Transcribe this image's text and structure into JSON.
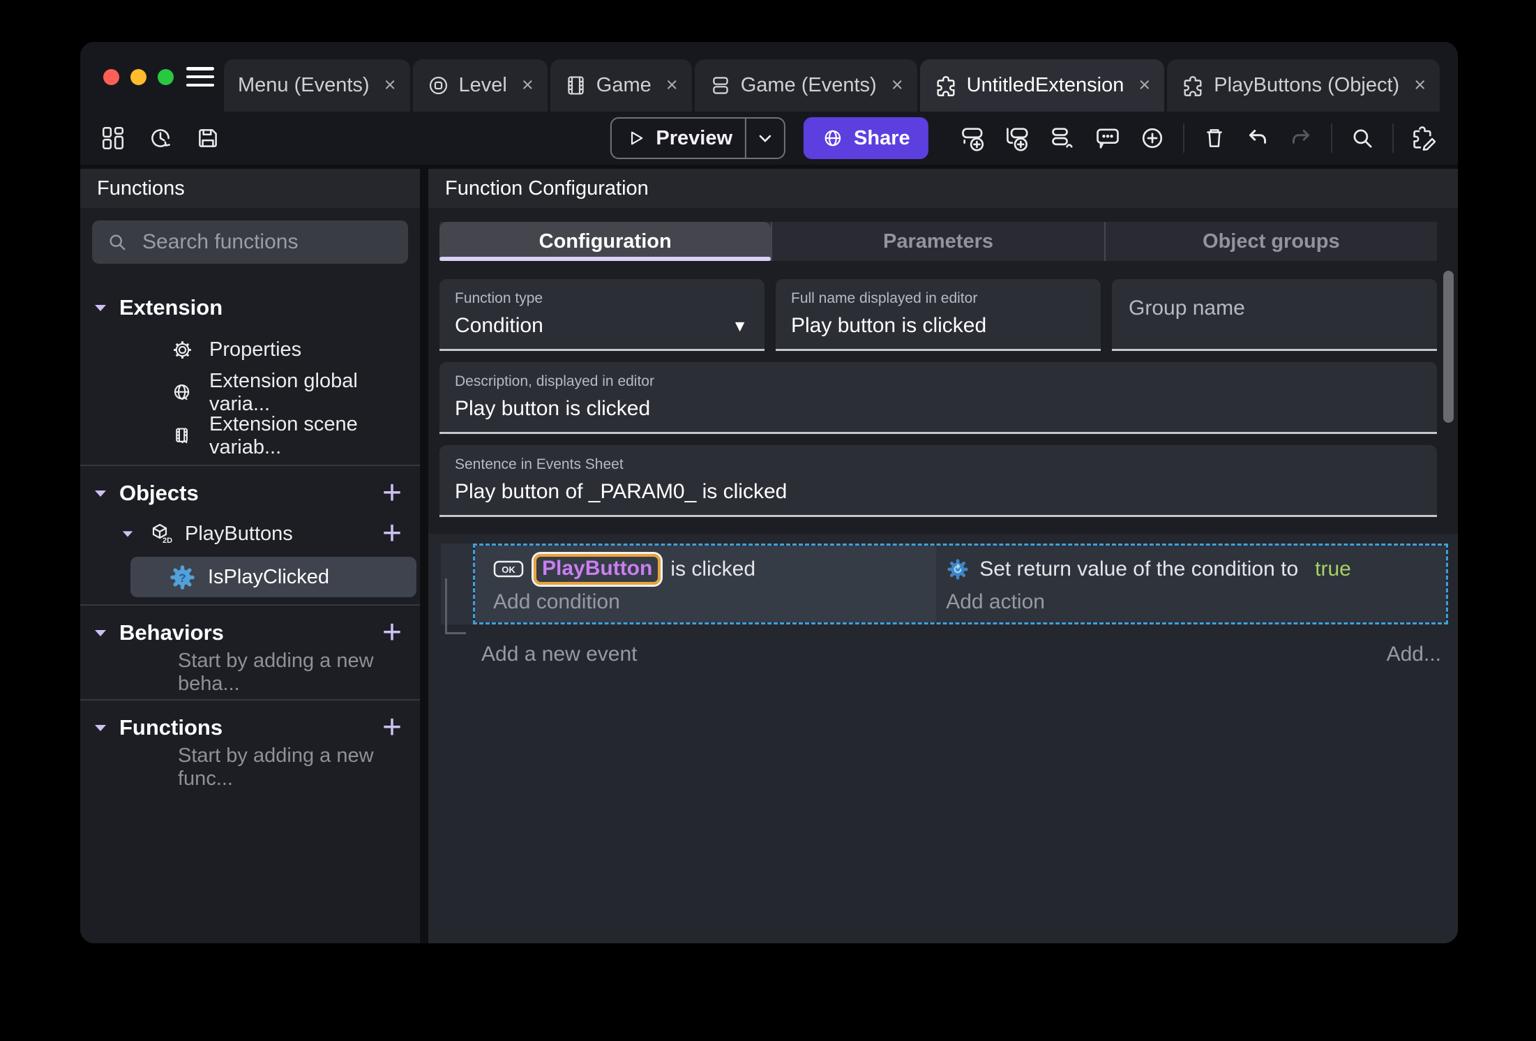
{
  "glyphs": {
    "close": "×",
    "plus": "+",
    "caret_down": "▼"
  },
  "window": {
    "tabs": [
      {
        "label": "Menu (Events)",
        "active": false
      },
      {
        "label": "Level",
        "active": false
      },
      {
        "label": "Game",
        "active": false
      },
      {
        "label": "Game (Events)",
        "active": false
      },
      {
        "label": "UntitledExtension",
        "active": true
      },
      {
        "label": "PlayButtons (Object)",
        "active": false
      }
    ]
  },
  "toolbar": {
    "preview_label": "Preview",
    "share_label": "Share"
  },
  "sidebar": {
    "title": "Functions",
    "search_placeholder": "Search functions",
    "extension": {
      "label": "Extension",
      "items": [
        {
          "label": "Properties"
        },
        {
          "label": "Extension global varia..."
        },
        {
          "label": "Extension scene variab..."
        }
      ]
    },
    "objects": {
      "label": "Objects",
      "object_label": "PlayButtons",
      "function_label": "IsPlayClicked"
    },
    "behaviors": {
      "label": "Behaviors",
      "empty": "Start by adding a new beha..."
    },
    "functions": {
      "label": "Functions",
      "empty": "Start by adding a new func..."
    }
  },
  "main": {
    "title": "Function Configuration",
    "tabs": [
      {
        "label": "Configuration",
        "active": true
      },
      {
        "label": "Parameters",
        "active": false
      },
      {
        "label": "Object groups",
        "active": false
      }
    ],
    "fields": {
      "function_type": {
        "label": "Function type",
        "value": "Condition"
      },
      "full_name": {
        "label": "Full name displayed in editor",
        "value": "Play button is clicked"
      },
      "group_name": {
        "placeholder": "Group name"
      },
      "description": {
        "label": "Description, displayed in editor",
        "value": "Play button is clicked"
      },
      "sentence": {
        "label": "Sentence in Events Sheet",
        "value": "Play button of _PARAM0_ is clicked"
      }
    },
    "events": {
      "ok_badge": "OK",
      "condition_object": "PlayButton",
      "condition_suffix": "is clicked",
      "add_condition": "Add condition",
      "action_prefix": "Set return value of the condition to",
      "action_value": "true",
      "add_action": "Add action",
      "add_new_event": "Add a new event",
      "add_more": "Add..."
    }
  },
  "colors": {
    "accent_purple": "#5d3fe0",
    "accent_lavender": "#cfc0f2",
    "selected_event_border": "#3f9fdc",
    "object_chip_text": "#c97ef0",
    "object_chip_border": "#e8a33d",
    "boolean_true": "#a8d164",
    "traffic_close": "#ff5f57",
    "traffic_minimize": "#febc2e",
    "traffic_zoom": "#28c840"
  },
  "icons": [
    "menu",
    "scene",
    "game",
    "events-sheet",
    "extension-puzzle",
    "project-manager",
    "history",
    "save",
    "play",
    "chevron-down",
    "globe",
    "add-event",
    "add-subevent",
    "add-other-events",
    "add-comment",
    "add-circle",
    "trash",
    "undo",
    "redo",
    "search",
    "edit-extension",
    "gear",
    "global-variable",
    "scene-variable",
    "cube-2d",
    "function-question",
    "ok-button",
    "action-gear"
  ]
}
